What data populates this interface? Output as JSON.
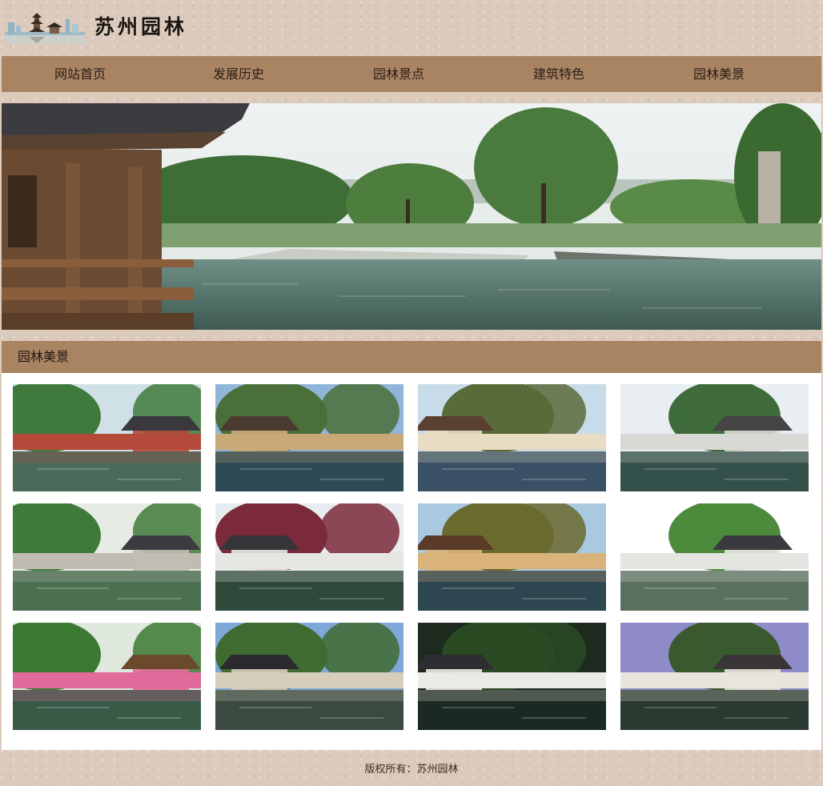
{
  "header": {
    "title": "苏州园林"
  },
  "nav": {
    "items": [
      "网站首页",
      "发展历史",
      "园林景点",
      "建筑特色",
      "园林美景"
    ]
  },
  "gallery": {
    "title": "园林美景",
    "photos": [
      {
        "sky": "#cfe0e6",
        "tree": "#3f7a3c",
        "roof": "#3a3a3e",
        "wall": "#b44a3a",
        "water": "#4a6a5a"
      },
      {
        "sky": "#8fb6d8",
        "tree": "#4b6f3a",
        "roof": "#4a3a30",
        "wall": "#c9a877",
        "water": "#2e4a55"
      },
      {
        "sky": "#c7dbe9",
        "tree": "#5a6b3a",
        "roof": "#5a4030",
        "wall": "#e8dcc2",
        "water": "#3a5065"
      },
      {
        "sky": "#e8eef2",
        "tree": "#3e6b3a",
        "roof": "#444444",
        "wall": "#d8d8d4",
        "water": "#34504a"
      },
      {
        "sky": "#e6ece4",
        "tree": "#3f7a3a",
        "roof": "#3c3c40",
        "wall": "#c0bcb2",
        "water": "#4b7050"
      },
      {
        "sky": "#e6ecf0",
        "tree": "#7a2a3a",
        "roof": "#35353a",
        "wall": "#e6e6e2",
        "water": "#2f4a3a"
      },
      {
        "sky": "#a9c9e0",
        "tree": "#6b6a2e",
        "roof": "#5a3a28",
        "wall": "#d9b37a",
        "water": "#2e4650"
      },
      {
        "sky": "#ffffff",
        "tree": "#4c8a3c",
        "roof": "#3a3a3e",
        "wall": "#e4e4e0",
        "water": "#5a7060"
      },
      {
        "sky": "#dfe8dc",
        "tree": "#3c7a34",
        "roof": "#6a4a2a",
        "wall": "#e06a9a",
        "water": "#3a5a48"
      },
      {
        "sky": "#7fa8d8",
        "tree": "#3f6a30",
        "roof": "#2a2a2e",
        "wall": "#d6cdbb",
        "water": "#3a4a40"
      },
      {
        "sky": "#1e2a1e",
        "tree": "#2a4a24",
        "roof": "#2e2e32",
        "wall": "#eceae4",
        "water": "#1a2a22"
      },
      {
        "sky": "#8f8ac8",
        "tree": "#3a5a2e",
        "roof": "#3a3638",
        "wall": "#e8e4dc",
        "water": "#2a3a30"
      }
    ]
  },
  "footer": {
    "copyright": "版权所有：苏州园林"
  },
  "colors": {
    "nav_bg": "#a98463",
    "page_bg": "#dccbbd"
  }
}
